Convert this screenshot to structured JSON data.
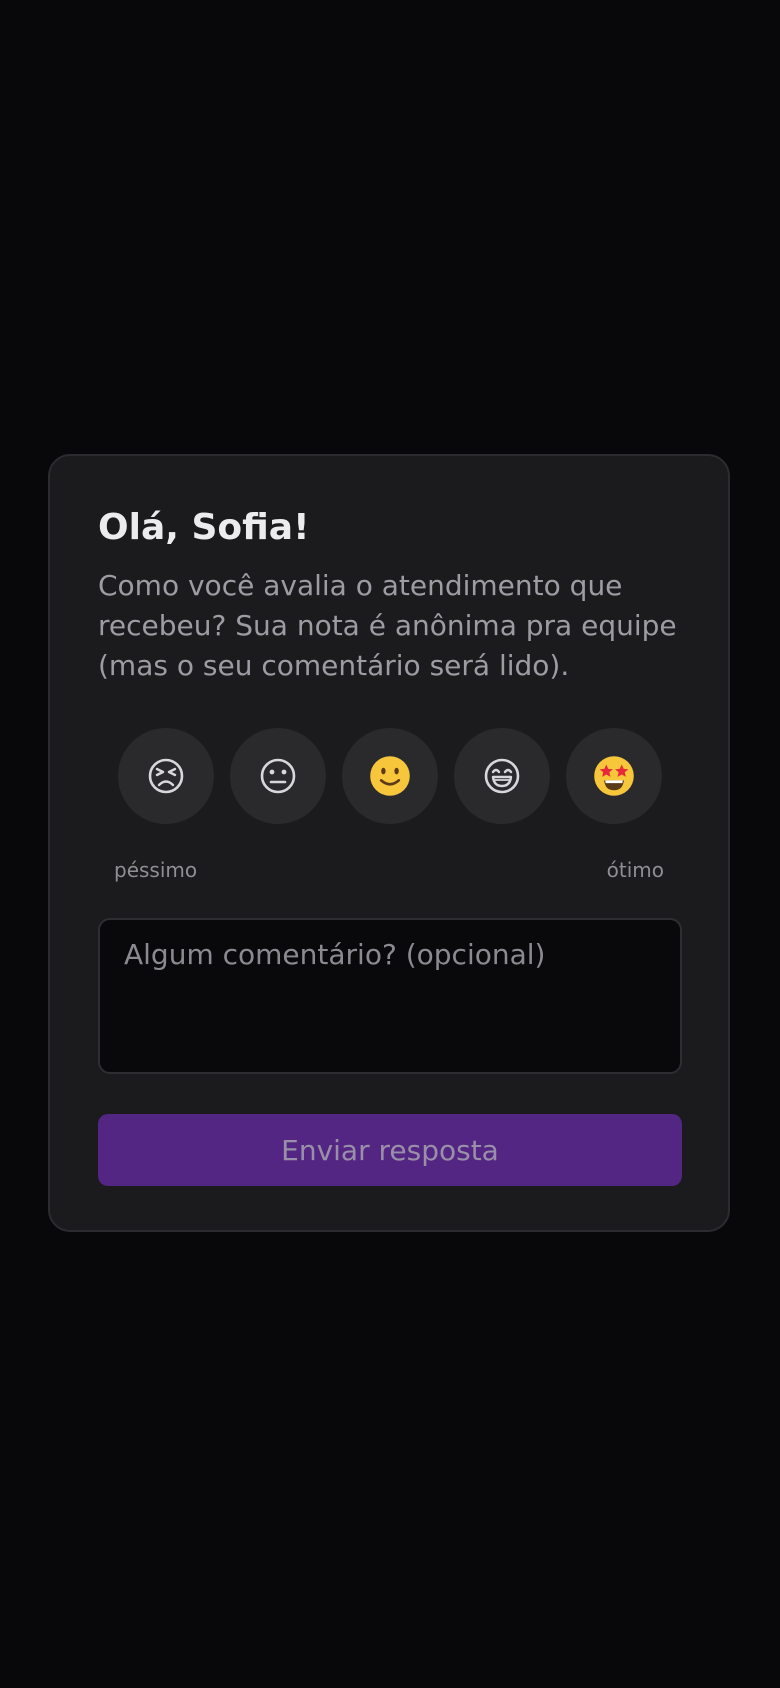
{
  "card": {
    "title": "Olá, Sofia!",
    "subtitle": "Como você avalia o atendimento que recebeu? Sua nota é anônima pra equipe (mas o seu comentário será lido).",
    "rating": {
      "options": [
        {
          "icon": "persevering-face-icon",
          "emoji": "😣"
        },
        {
          "icon": "neutral-face-icon",
          "emoji": "😐"
        },
        {
          "icon": "slightly-smiling-face-icon",
          "emoji": "🙂"
        },
        {
          "icon": "grinning-face-icon",
          "emoji": "😄"
        },
        {
          "icon": "star-struck-face-icon",
          "emoji": "🤩"
        }
      ],
      "low_label": "péssimo",
      "high_label": "ótimo"
    },
    "comment": {
      "value": "",
      "placeholder": "Algum comentário? (opcional)"
    },
    "submit_label": "Enviar resposta"
  },
  "colors": {
    "page_background": "#08080a",
    "card_background": "#1b1b1d",
    "face_background": "#2a2a2d",
    "accent": "#532683",
    "text_primary": "#ececef",
    "text_secondary": "#9c9ca3"
  }
}
